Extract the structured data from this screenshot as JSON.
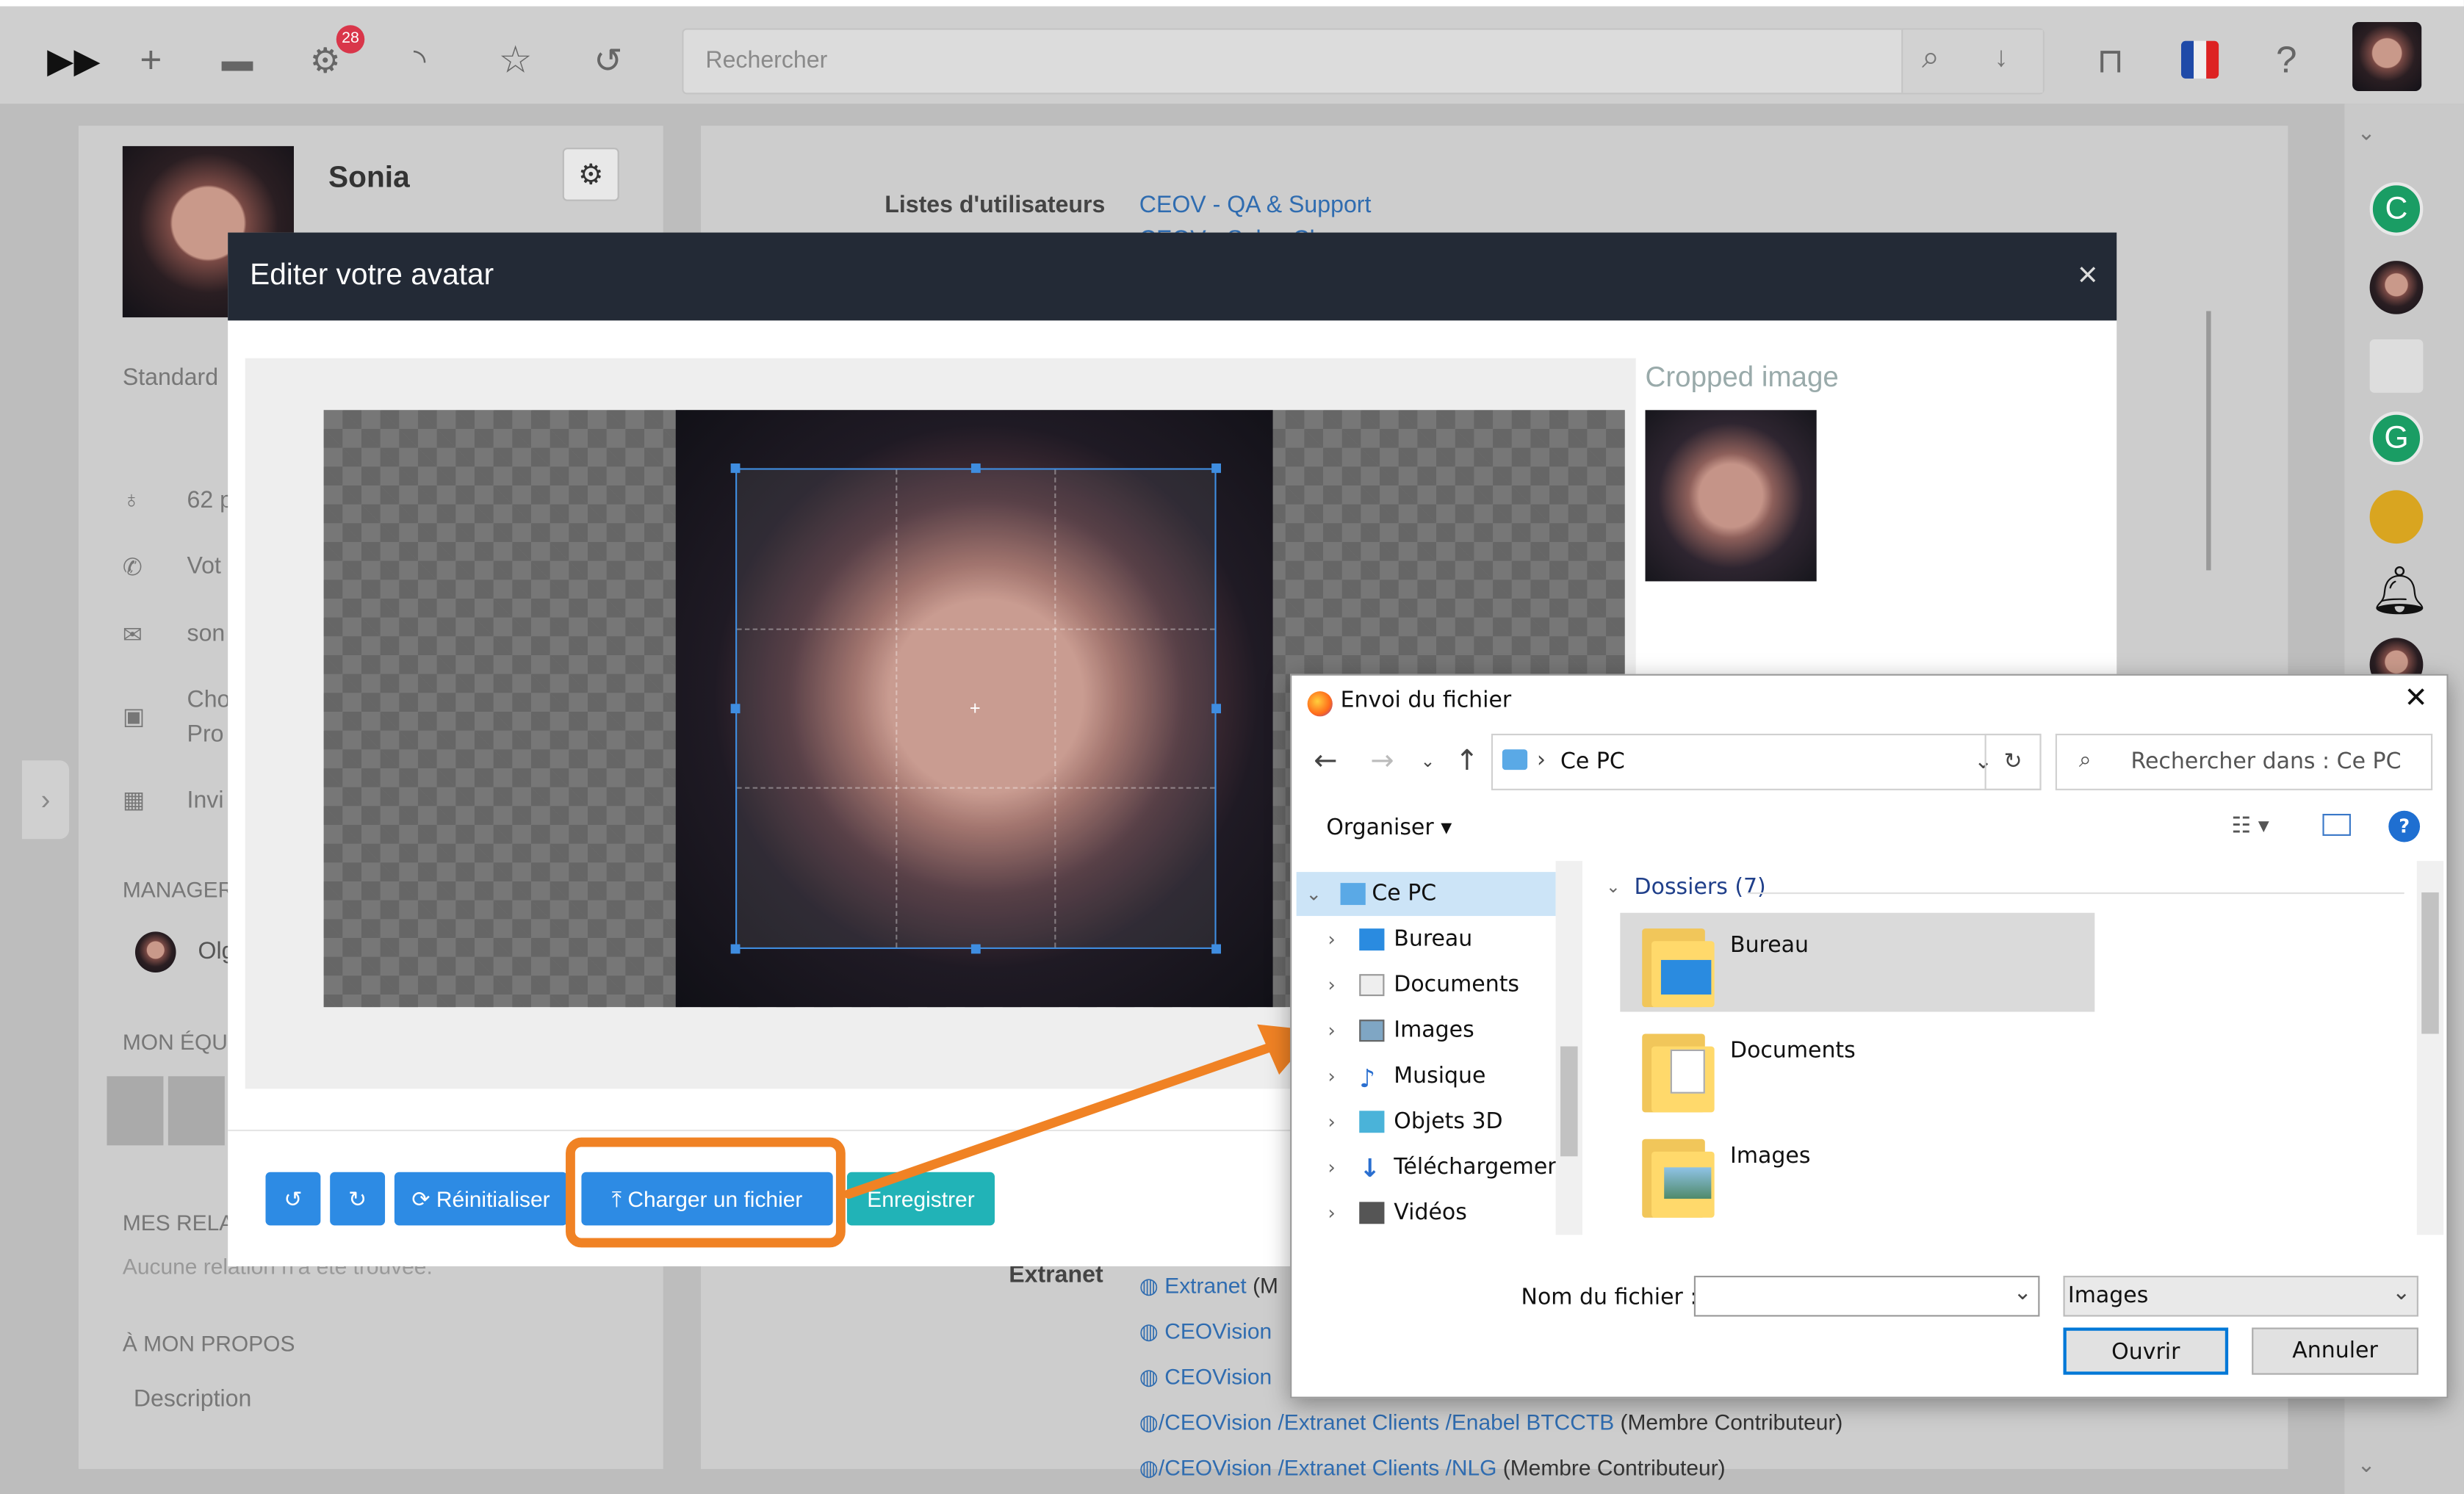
{
  "topbar": {
    "notification_count": "28",
    "search_placeholder": "Rechercher"
  },
  "profile": {
    "name": "Sonia",
    "standard_label": "Standard",
    "info": [
      "62 p",
      "Vot",
      "son",
      "Cho",
      "Pro",
      "Invi"
    ],
    "manager_label": "MANAGER",
    "manager_name": "Olg",
    "team_label": "MON ÉQU",
    "relations_label": "MES RELA",
    "relations_empty": "Aucune relation n'a été trouvée.",
    "about_label": "À MON PROPOS",
    "description_label": "Description"
  },
  "main": {
    "user_lists_label": "Listes d'utilisateurs",
    "user_list_1": "CEOV - QA & Support",
    "user_list_2": "CEOV - Sales Ch",
    "extranet_label": "Extranet",
    "extranet_rows": [
      {
        "a": "Extranet",
        "b": "",
        "c": "",
        "role": "(M"
      },
      {
        "a": "CEOVision",
        "b": "",
        "c": "",
        "role": ""
      },
      {
        "a": "CEOVision",
        "b": "",
        "c": "",
        "role": ""
      },
      {
        "a": "CEOVision",
        "b": "Extranet Clients",
        "c": "Enabel BTCCTB",
        "role": "(Membre Contributeur)"
      },
      {
        "a": "CEOVision",
        "b": "Extranet Clients",
        "c": "NLG",
        "role": "(Membre Contributeur)"
      }
    ]
  },
  "modal": {
    "title": "Editer votre avatar",
    "close": "×",
    "cropped_label": "Cropped image",
    "btn_reset": "Réinitialiser",
    "btn_upload": "Charger un fichier",
    "btn_save": "Enregistrer"
  },
  "file_dialog": {
    "title": "Envoi du fichier",
    "close": "✕",
    "location": "Ce PC",
    "search_placeholder": "Rechercher dans : Ce PC",
    "organize": "Organiser",
    "tree": [
      "Ce PC",
      "Bureau",
      "Documents",
      "Images",
      "Musique",
      "Objets 3D",
      "Téléchargements",
      "Vidéos"
    ],
    "group_label": "Dossiers (7)",
    "folders": [
      "Bureau",
      "Documents",
      "Images"
    ],
    "filename_label": "Nom du fichier :",
    "filename_value": "",
    "filter_value": "Images",
    "btn_open": "Ouvrir",
    "btn_cancel": "Annuler"
  },
  "rail": {
    "letters": [
      "C",
      "G"
    ]
  },
  "colors": {
    "accent_blue": "#2d8be4",
    "teal": "#21b3b7",
    "highlight_orange": "#f08224",
    "modal_header": "#232a36",
    "link": "#2f6cb0"
  }
}
